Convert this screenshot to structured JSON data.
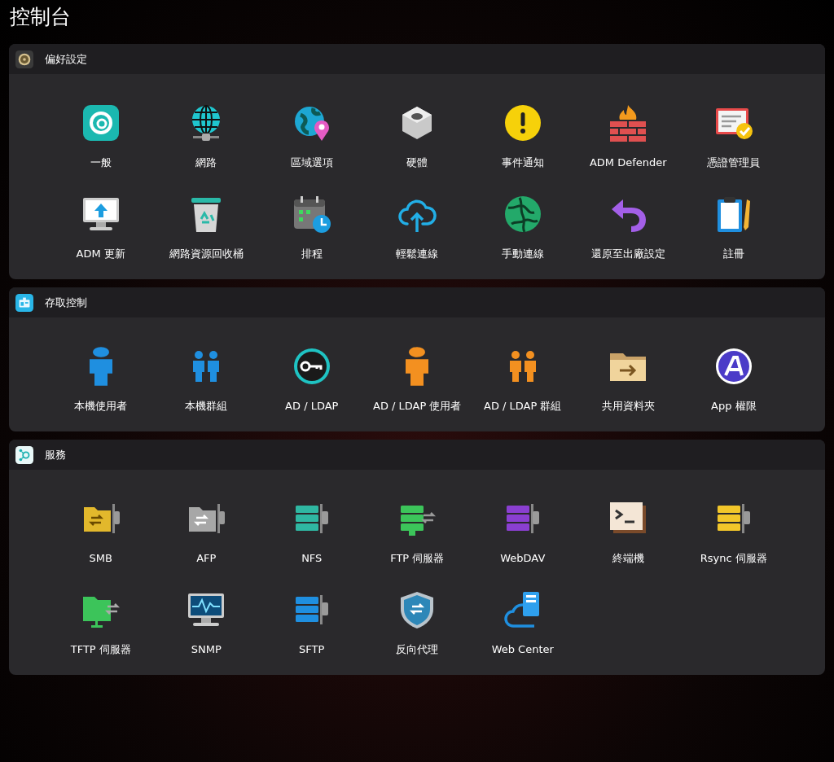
{
  "title": "控制台",
  "sections": [
    {
      "title": "偏好設定",
      "items": [
        {
          "label": "一般"
        },
        {
          "label": "網路"
        },
        {
          "label": "區域選項"
        },
        {
          "label": "硬體"
        },
        {
          "label": "事件通知"
        },
        {
          "label": "ADM Defender"
        },
        {
          "label": "憑證管理員"
        },
        {
          "label": "ADM 更新"
        },
        {
          "label": "網路資源回收桶"
        },
        {
          "label": "排程"
        },
        {
          "label": "輕鬆連線"
        },
        {
          "label": "手動連線"
        },
        {
          "label": "還原至出廠設定"
        },
        {
          "label": "註冊"
        }
      ]
    },
    {
      "title": "存取控制",
      "items": [
        {
          "label": "本機使用者"
        },
        {
          "label": "本機群組"
        },
        {
          "label": "AD / LDAP"
        },
        {
          "label": "AD / LDAP 使用者"
        },
        {
          "label": "AD / LDAP 群組"
        },
        {
          "label": "共用資料夾"
        },
        {
          "label": "App 權限"
        }
      ]
    },
    {
      "title": "服務",
      "items": [
        {
          "label": "SMB"
        },
        {
          "label": "AFP"
        },
        {
          "label": "NFS"
        },
        {
          "label": "FTP 伺服器"
        },
        {
          "label": "WebDAV"
        },
        {
          "label": "終端機"
        },
        {
          "label": "Rsync 伺服器"
        },
        {
          "label": "TFTP 伺服器"
        },
        {
          "label": "SNMP"
        },
        {
          "label": "SFTP"
        },
        {
          "label": "反向代理"
        },
        {
          "label": "Web Center"
        }
      ]
    }
  ]
}
